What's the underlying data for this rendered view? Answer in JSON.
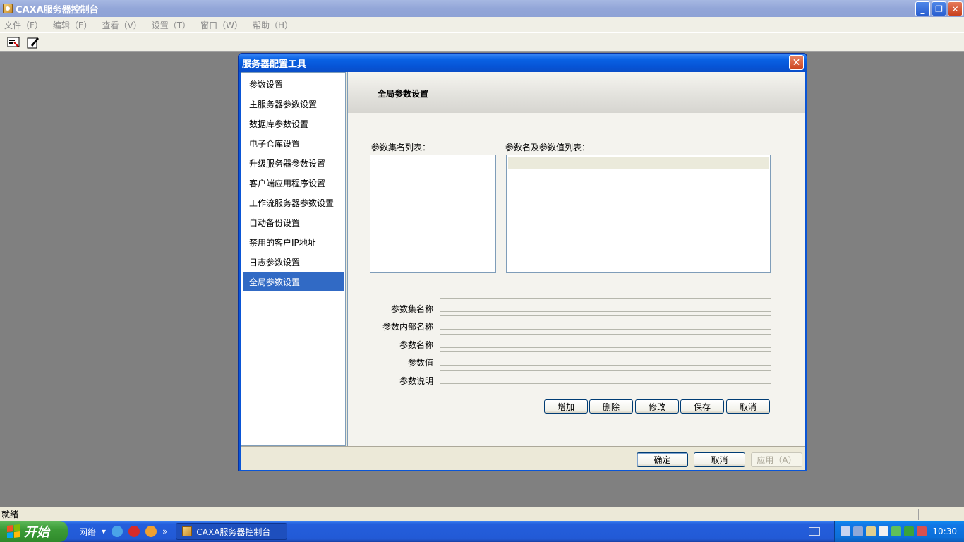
{
  "app": {
    "title": "CAXA服务器控制台"
  },
  "menu": [
    "文件（F）",
    "编辑（E）",
    "查看（V）",
    "设置（T）",
    "窗口（W）",
    "帮助（H）"
  ],
  "status": {
    "text": "就绪"
  },
  "taskbar": {
    "start": "开始",
    "quicklaunch_label": "网络",
    "task_item": "CAXA服务器控制台",
    "time": "10:30",
    "more": "»"
  },
  "dialog": {
    "title": "服务器配置工具",
    "close": "✕",
    "nav": [
      "参数设置",
      "主服务器参数设置",
      "数据库参数设置",
      "电子仓库设置",
      "升级服务器参数设置",
      "客户端应用程序设置",
      "工作流服务器参数设置",
      "自动备份设置",
      "禁用的客户IP地址",
      "日志参数设置",
      "全局参数设置"
    ],
    "selected_nav": "全局参数设置",
    "panel": {
      "title": "全局参数设置",
      "list1_label": "参数集名列表：",
      "list2_label": "参数名及参数值列表：",
      "fields": [
        {
          "label": "参数集名称",
          "value": ""
        },
        {
          "label": "参数内部名称",
          "value": ""
        },
        {
          "label": "参数名称",
          "value": ""
        },
        {
          "label": "参数值",
          "value": ""
        },
        {
          "label": "参数说明",
          "value": ""
        }
      ],
      "buttons": [
        "增加",
        "删除",
        "修改",
        "保存",
        "取消"
      ]
    },
    "footer": {
      "ok": "确定",
      "cancel": "取消",
      "apply": "应用（A）"
    }
  },
  "colors": {
    "selection": "#316ac5",
    "titlebar": "#0a62e4",
    "taskbar": "#245edc"
  }
}
